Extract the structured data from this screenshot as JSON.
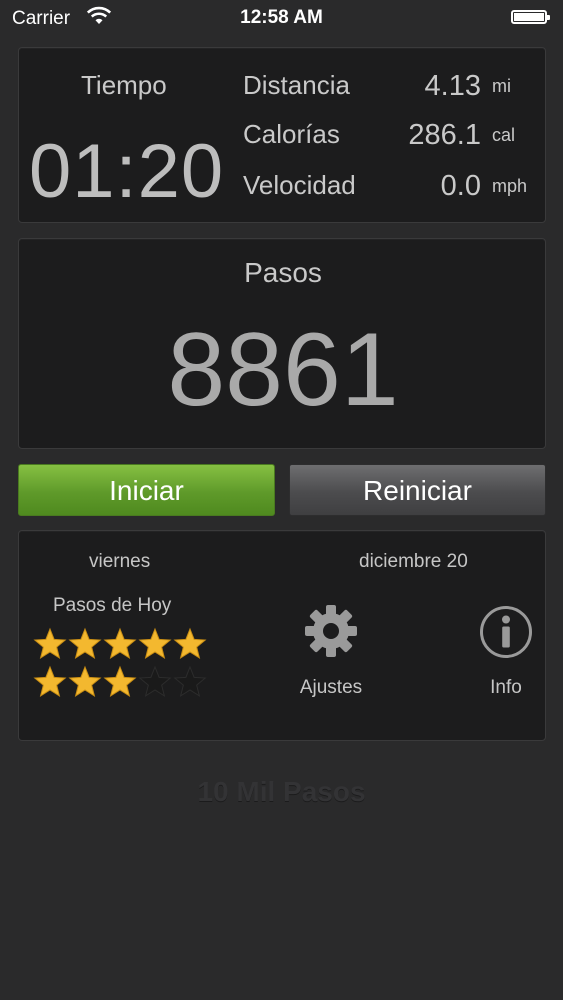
{
  "status_bar": {
    "carrier": "Carrier",
    "time": "12:58 AM"
  },
  "stats": {
    "time_label": "Tiempo",
    "timer": "01:20",
    "rows": [
      {
        "name": "Distancia",
        "value": "4.13",
        "unit": "mi"
      },
      {
        "name": "Calorías",
        "value": "286.1",
        "unit": "cal"
      },
      {
        "name": "Velocidad",
        "value": "0.0",
        "unit": "mph"
      }
    ]
  },
  "steps": {
    "title": "Pasos",
    "count": "8861"
  },
  "buttons": {
    "start": "Iniciar",
    "reset": "Reiniciar"
  },
  "today": {
    "weekday": "viernes",
    "date": "diciembre 20",
    "steps_label": "Pasos de Hoy",
    "stars_filled": 8,
    "stars_total": 10,
    "settings_label": "Ajustes",
    "info_label": "Info"
  },
  "brand": "10 Mil Pasos",
  "colors": {
    "background": "#2a2a2b",
    "panel": "#1c1c1d",
    "start_button": "#6aa831",
    "reset_button": "#555557",
    "star_filled": "#f3b82f",
    "star_empty": "#1a1a1a"
  },
  "icons": {
    "status_wifi": "wifi-icon",
    "status_battery": "battery-icon",
    "settings": "gear-icon",
    "info": "info-icon",
    "rating": "star-icon"
  }
}
